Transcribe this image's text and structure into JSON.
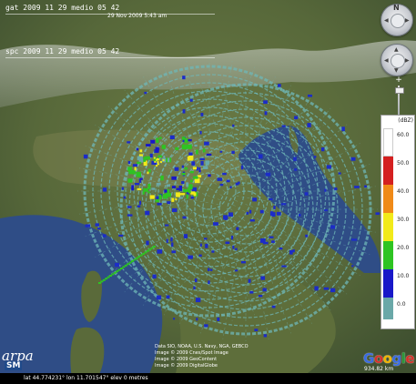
{
  "overlays": {
    "gat_label": "gat 2009 11 29 medio 05 42",
    "spc_label": "spc 2009 11 29 medio 05 42",
    "timestamp": "29 Nov 2009 5:43 am"
  },
  "legend": {
    "title": "(dBZ)",
    "entries": [
      {
        "label": "60.0",
        "color": "#ffffff"
      },
      {
        "label": "50.0",
        "color": "#d42020"
      },
      {
        "label": "40.0",
        "color": "#f08a18"
      },
      {
        "label": "30.0",
        "color": "#f2ea1a"
      },
      {
        "label": "20.0",
        "color": "#2ec422"
      },
      {
        "label": "10.0",
        "color": "#1818c8"
      },
      {
        "label": "0.0",
        "color": "#6aa8a8"
      }
    ]
  },
  "navigation": {
    "look_icon": "look-around-icon",
    "move_icon": "move-pan-icon",
    "zoom_plus": "+",
    "zoom_minus": "−",
    "north_label": "N"
  },
  "credits": {
    "line1": "Data SIO, NOAA, U.S. Navy, NGA, GEBCO",
    "line2": "Image © 2009 Cnes/Spot Image",
    "line3": "Image © 2009 GeoContent",
    "line4": "Image © 2009 DigitalGlobe"
  },
  "google_logo": "Google",
  "eye_altitude": "934.82 km",
  "status_bar": {
    "coords": "lat  44.774231°  lon  11.701547°  elev  0 metres"
  },
  "logo": {
    "top": "arpa",
    "bottom": "SM"
  },
  "colors": {
    "sea": "#2f4d86",
    "land": "#5b6e3a",
    "radar_ring": "#6fb7b7",
    "radar_cell": "#1c2cc8"
  }
}
